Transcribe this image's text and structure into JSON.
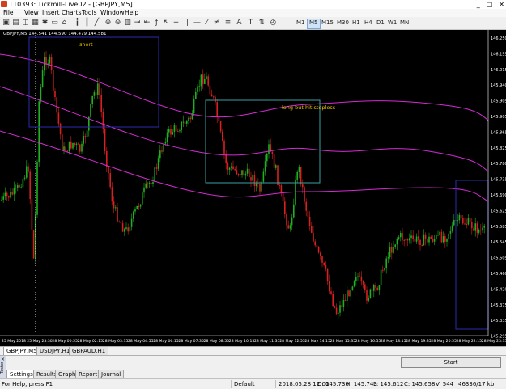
{
  "window": {
    "title": "110393: Tickmill-Live02 - [GBPJPY,M5]",
    "controls": [
      "_",
      "□",
      "✕"
    ]
  },
  "menu": [
    "File",
    "View",
    "Insert",
    "Charts",
    "Tools",
    "Window",
    "Help"
  ],
  "toolbar": {
    "timeframes": [
      "M1",
      "M5",
      "M15",
      "M30",
      "H1",
      "H4",
      "D1",
      "W1",
      "MN"
    ],
    "active_timeframe": "M5"
  },
  "chart": {
    "header": "GBPJPY,M5  144.541 144.590 144.479 144.581",
    "annotations": {
      "short": "short",
      "long": "long but hit stoploss"
    },
    "price_labels": [
      "146.250",
      "146.155",
      "146.015",
      "145.940",
      "145.905",
      "145.905",
      "145.865",
      "145.825",
      "145.780",
      "145.735",
      "145.690",
      "145.625",
      "145.585",
      "145.545",
      "145.505",
      "145.460",
      "145.420",
      "145.375",
      "145.335",
      "145.295"
    ],
    "time_labels": [
      "25 May 2018",
      "25 May 23:30",
      "28 May 00:55",
      "28 May 02:15",
      "28 May 03:35",
      "28 May 04:55",
      "28 May 06:15",
      "28 May 07:35",
      "28 May 08:55",
      "28 May 10:15",
      "28 May 11:35",
      "28 May 12:55",
      "28 May 14:15",
      "28 May 15:35",
      "28 May 16:55",
      "28 May 18:15",
      "28 May 19:35",
      "28 May 20:55",
      "28 May 22:15",
      "28 May 23:35"
    ]
  },
  "symbol_tabs": [
    "GBPJPY,M5",
    "USDJPY,H1",
    "GBPAUD,H1"
  ],
  "symbol_tab_active": "GBPJPY,M5",
  "tester": {
    "side_label": "Tester",
    "close": "×",
    "start_label": "Start",
    "tabs": [
      "Settings",
      "Results",
      "Graph",
      "Report",
      "Journal"
    ],
    "active_tab": "Settings"
  },
  "statusbar": {
    "help": "For Help, press F1",
    "profile": "Default",
    "datetime": "2018.05.28 12:00",
    "open": "O: 145.730",
    "high": "H: 145.743",
    "low": "L: 145.612",
    "close": "C: 145.658",
    "volume": "V: 544",
    "traffic": "46336/17 kb"
  }
}
